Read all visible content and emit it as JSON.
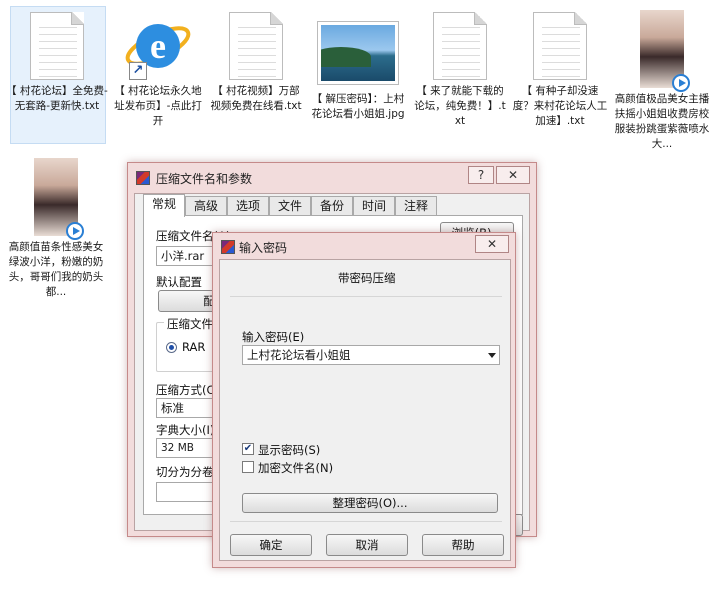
{
  "files": [
    {
      "label": "【 村花论坛】全免费-无套路-更新快.txt",
      "type": "text-icon"
    },
    {
      "label": "【 村花论坛永久地址发布页】-点此打开",
      "type": "ie-icon"
    },
    {
      "label": "【 村花视频】万部视频免费在线看.txt",
      "type": "text-icon"
    },
    {
      "label": "【 解压密码】：上村花论坛看小姐姐.jpg",
      "type": "image-icon"
    },
    {
      "label": "【 来了就能下载的论坛，纯免费！】.txt",
      "type": "text-icon"
    },
    {
      "label": "【 有种子却没速度？来村花论坛人工加速】.txt",
      "type": "text-icon"
    },
    {
      "label": "高颜值极品美女主播扶摇小姐姐收费房校服装扮跳蛋紫薇喷水大...",
      "type": "video-icon"
    },
    {
      "label": "高颜值苗条性感美女绿波小洋，粉嫩的奶头，哥哥们我的奶头都...",
      "type": "video-icon"
    }
  ],
  "archive_dialog": {
    "title": "压缩文件名和参数",
    "help_btn": "?",
    "close_btn": "✕",
    "tabs": [
      "常规",
      "高级",
      "选项",
      "文件",
      "备份",
      "时间",
      "注释"
    ],
    "active_tab": "常规",
    "archive_name_label": "压缩文件名(A)",
    "archive_name_value": "小洋.rar",
    "browse_btn": "浏览(B)...",
    "default_profile_label": "默认配置",
    "profiles_btn": "配置(F)...",
    "format_group_label": "压缩文件格式",
    "format_rar": "RAR",
    "method_label": "压缩方式(C)",
    "method_value": "标准",
    "dict_label": "字典大小(I)",
    "dict_value": "32 MB",
    "split_label": "切分为分卷(V)"
  },
  "password_dialog": {
    "title": "输入密码",
    "close_btn": "✕",
    "heading": "带密码压缩",
    "password_label": "输入密码(E)",
    "password_value": "上村花论坛看小姐姐",
    "show_password_label": "显示密码(S)",
    "show_password_checked": true,
    "encrypt_names_label": "加密文件名(N)",
    "encrypt_names_checked": false,
    "organize_btn": "整理密码(O)...",
    "ok_btn": "确定",
    "cancel_btn": "取消",
    "help_btn": "帮助"
  }
}
